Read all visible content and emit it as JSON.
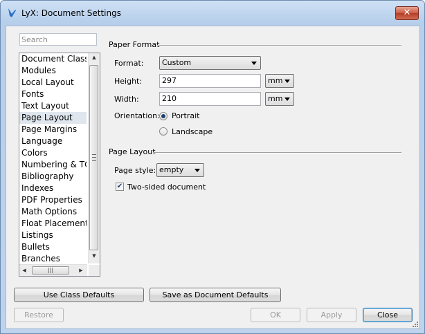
{
  "window": {
    "title": "LyX: Document Settings"
  },
  "sidebar": {
    "search_placeholder": "Search",
    "items": [
      {
        "label": "Document Class"
      },
      {
        "label": "Modules"
      },
      {
        "label": "Local Layout"
      },
      {
        "label": "Fonts"
      },
      {
        "label": "Text Layout"
      },
      {
        "label": "Page Layout",
        "selected": true
      },
      {
        "label": "Page Margins"
      },
      {
        "label": "Language"
      },
      {
        "label": "Colors"
      },
      {
        "label": "Numbering & TOC"
      },
      {
        "label": "Bibliography"
      },
      {
        "label": "Indexes"
      },
      {
        "label": "PDF Properties"
      },
      {
        "label": "Math Options"
      },
      {
        "label": "Float Placement"
      },
      {
        "label": "Listings"
      },
      {
        "label": "Bullets"
      },
      {
        "label": "Branches"
      }
    ]
  },
  "paper_format": {
    "section_title": "Paper Format",
    "format_label": "Format:",
    "format_value": "Custom",
    "height_label": "Height:",
    "height_value": "297",
    "height_unit": "mm",
    "width_label": "Width:",
    "width_value": "210",
    "width_unit": "mm",
    "orientation_label": "Orientation:",
    "portrait_label": "Portrait",
    "landscape_label": "Landscape",
    "orientation_selected": "Portrait"
  },
  "page_layout": {
    "section_title": "Page Layout",
    "page_style_label": "Page style:",
    "page_style_value": "empty",
    "two_sided_label": "Two-sided document",
    "two_sided_checked": true
  },
  "buttons": {
    "use_class_defaults": "Use Class Defaults",
    "save_as_defaults": "Save as Document Defaults",
    "restore": "Restore",
    "ok": "OK",
    "apply": "Apply",
    "close": "Close"
  },
  "colors": {
    "accent": "#1c3f72",
    "window_frame": "#b7cfeb",
    "selection": "#dfe6ee"
  }
}
